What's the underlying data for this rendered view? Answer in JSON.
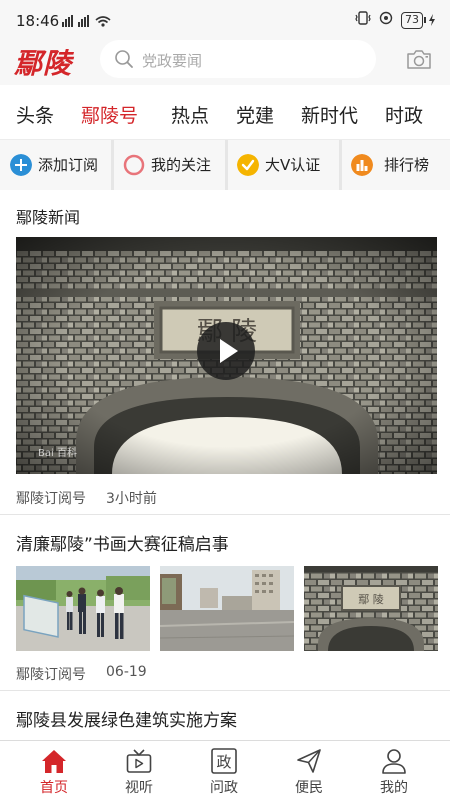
{
  "status_bar": {
    "time": "18:46",
    "left_icons": "⁴ᴳ ᵢₗ ⁴ᴳ ᵢₗ",
    "battery": "73"
  },
  "header": {
    "logo_text": "鄢陵",
    "search_placeholder": "党政要闻"
  },
  "tabs": [
    {
      "label": "头条",
      "active": false
    },
    {
      "label": "鄢陵号",
      "active": true
    },
    {
      "label": "热点",
      "active": false
    },
    {
      "label": "党建",
      "active": false
    },
    {
      "label": "新时代",
      "active": false
    },
    {
      "label": "时政",
      "active": false
    }
  ],
  "actions": [
    {
      "label": "添加订阅",
      "icon": "plus-circle-icon",
      "color": "#2b8fd6"
    },
    {
      "label": "我的关注",
      "icon": "ring-icon",
      "color": "#e8747a"
    },
    {
      "label": "大V认证",
      "icon": "check-circle-icon",
      "color": "#f5b400"
    },
    {
      "label": "排行榜",
      "icon": "bar-chart-icon",
      "color": "#f08a1e"
    }
  ],
  "feed": {
    "section_title": "鄢陵新闻",
    "video": {
      "gate_sign": "鄢 陵",
      "watermark": "Bai 百科",
      "source": "鄢陵订阅号",
      "time": "3小时前"
    },
    "article1": {
      "title": "清廉鄢陵”书画大赛征稿启事",
      "source": "鄢陵订阅号",
      "time": "06-19"
    },
    "article2": {
      "title": "鄢陵县发展绿色建筑实施方案"
    }
  },
  "bottom_nav": [
    {
      "label": "首页",
      "icon": "home-icon",
      "active": true
    },
    {
      "label": "视听",
      "icon": "tv-icon",
      "active": false
    },
    {
      "label": "问政",
      "icon": "zheng-icon",
      "glyph": "政",
      "active": false
    },
    {
      "label": "便民",
      "icon": "send-icon",
      "active": false
    },
    {
      "label": "我的",
      "icon": "user-icon",
      "active": false
    }
  ],
  "colors": {
    "accent": "#d4262a",
    "background": "#ffffff",
    "header_bg": "#f7f7f7"
  }
}
